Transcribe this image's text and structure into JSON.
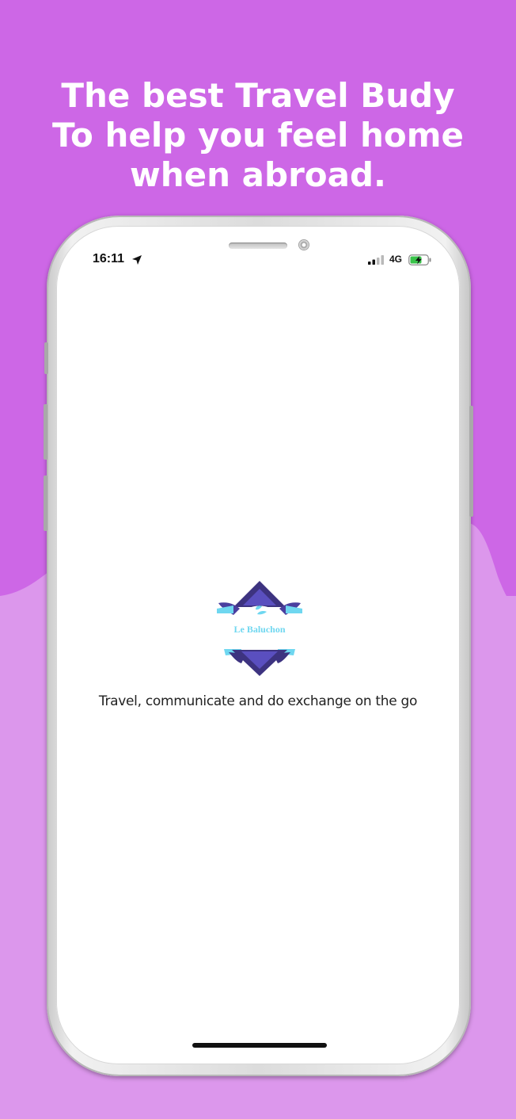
{
  "headline": {
    "line1": "The best Travel Budy",
    "line2": "To help you feel home",
    "line3": "when abroad."
  },
  "status_bar": {
    "time": "16:11",
    "network": "4G",
    "location_icon": "location-arrow-icon",
    "signal_icon": "cellular-signal-icon",
    "battery_icon": "battery-charging-icon"
  },
  "app": {
    "logo_text": "Le Baluchon",
    "tagline": "Travel, communicate and do exchange on the go"
  },
  "colors": {
    "background_top": "#cd67e6",
    "background_bottom": "#dc97ec",
    "logo_dark": "#3d3380",
    "logo_mid": "#5a4fbf",
    "logo_accent": "#6fd7f0",
    "battery_green": "#39c34a"
  }
}
